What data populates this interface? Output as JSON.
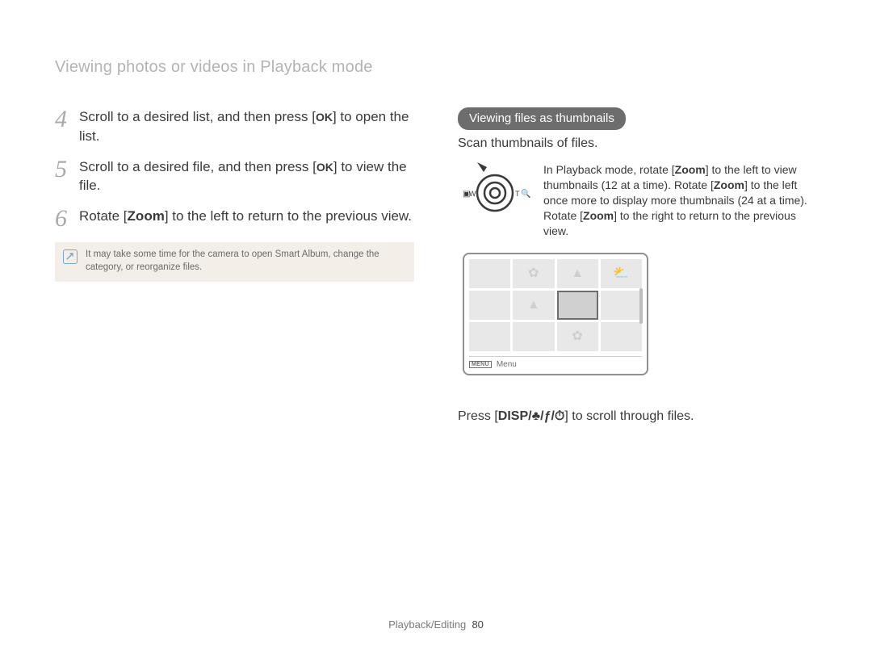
{
  "page_title": "Viewing photos or videos in Playback mode",
  "left": {
    "steps": [
      {
        "num": "4",
        "pre": "Scroll to a desired list, and then press [",
        "icon": "OK",
        "post": "] to open the list."
      },
      {
        "num": "5",
        "pre": "Scroll to a desired file, and then press [",
        "icon": "OK",
        "post": "] to view the file."
      },
      {
        "num": "6",
        "pre": "Rotate [",
        "icon_bold": "Zoom",
        "post": "] to the left to return to the previous view."
      }
    ],
    "note": "It may take some time for the camera to open Smart Album, change the category, or reorganize files."
  },
  "right": {
    "heading": "Viewing files as thumbnails",
    "scan_line": "Scan thumbnails of files.",
    "dial_labels": {
      "left": "W",
      "right": "T"
    },
    "zoom_para": {
      "a": "In Playback mode, rotate [",
      "z1": "Zoom",
      "b": "] to the left to view thumbnails (12 at a time). Rotate [",
      "z2": "Zoom",
      "c": "] to the left once more to display more thumbnails (24 at a time). Rotate [",
      "z3": "Zoom",
      "d": "] to the right to return to the previous view."
    },
    "device": {
      "menu_label": "Menu"
    },
    "press_line": {
      "pre": "Press [",
      "disp": "DISP",
      "sep": "/",
      "macro": "♣",
      "flash": "ƒ",
      "timer": "⏱",
      "post": "] to scroll through files."
    }
  },
  "footer": {
    "section": "Playback/Editing",
    "page": "80"
  }
}
